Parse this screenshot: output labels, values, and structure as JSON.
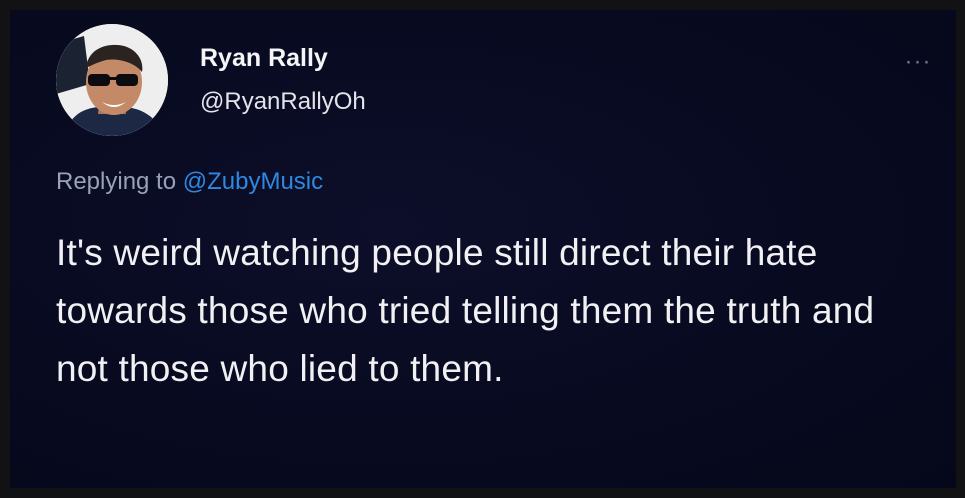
{
  "tweet": {
    "author": {
      "display_name": "Ryan Rally",
      "handle": "@RyanRallyOh",
      "avatar_icon": "profile-photo"
    },
    "more_icon": "more-horizontal-icon",
    "more_glyph": "···",
    "reply": {
      "prefix": "Replying to",
      "mention": "@ZubyMusic"
    },
    "text": "It's weird watching people still direct their hate towards those who tried telling them the truth and not those who lied to them."
  },
  "colors": {
    "background": "#080a20",
    "mention": "#2f88e0",
    "text": "#f1f1f4",
    "muted": "#9aa0b8"
  }
}
